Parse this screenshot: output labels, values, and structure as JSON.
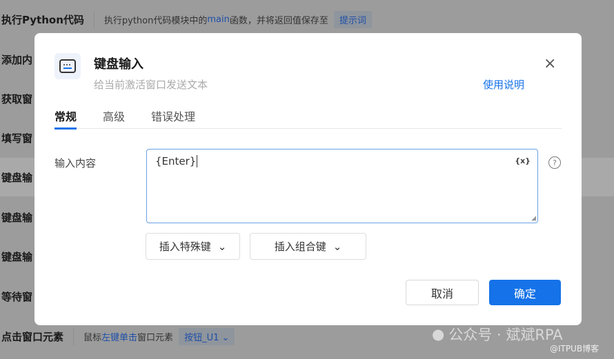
{
  "background": {
    "rows": [
      {
        "label": "执行Python代码",
        "desc_pre": "执行python代码模块中的",
        "desc_hl": "main",
        "desc_post": "函数，并将返回值保存至",
        "tag": "提示词"
      },
      {
        "label": "添加内"
      },
      {
        "label": "获取窗"
      },
      {
        "label": "填写窗"
      },
      {
        "label": "键盘输"
      },
      {
        "label": "键盘输"
      },
      {
        "label": "键盘输"
      },
      {
        "label": "等待窗"
      },
      {
        "label": "点击窗口元素",
        "desc_pre": "鼠标",
        "desc_hl": "左键单击",
        "desc_post": "窗口元素",
        "tag": "按钮_U1"
      }
    ]
  },
  "modal": {
    "title": "键盘输入",
    "subtitle": "给当前激活窗口发送文本",
    "help_link": "使用说明",
    "close": "×",
    "tabs": [
      {
        "label": "常规",
        "active": true
      },
      {
        "label": "高级"
      },
      {
        "label": "错误处理"
      }
    ],
    "field_label": "输入内容",
    "field_value": "{Enter}",
    "var_icon": "{x}",
    "help_icon": "?",
    "insert_special": "插入特殊键",
    "insert_combo": "插入组合键",
    "cancel": "取消",
    "ok": "确定"
  },
  "watermark": {
    "text": "公众号 · 斌斌RPA",
    "sub": "@ITPUB博客"
  },
  "colors": {
    "accent": "#1572e8",
    "overlay": "#9c9c9c"
  }
}
